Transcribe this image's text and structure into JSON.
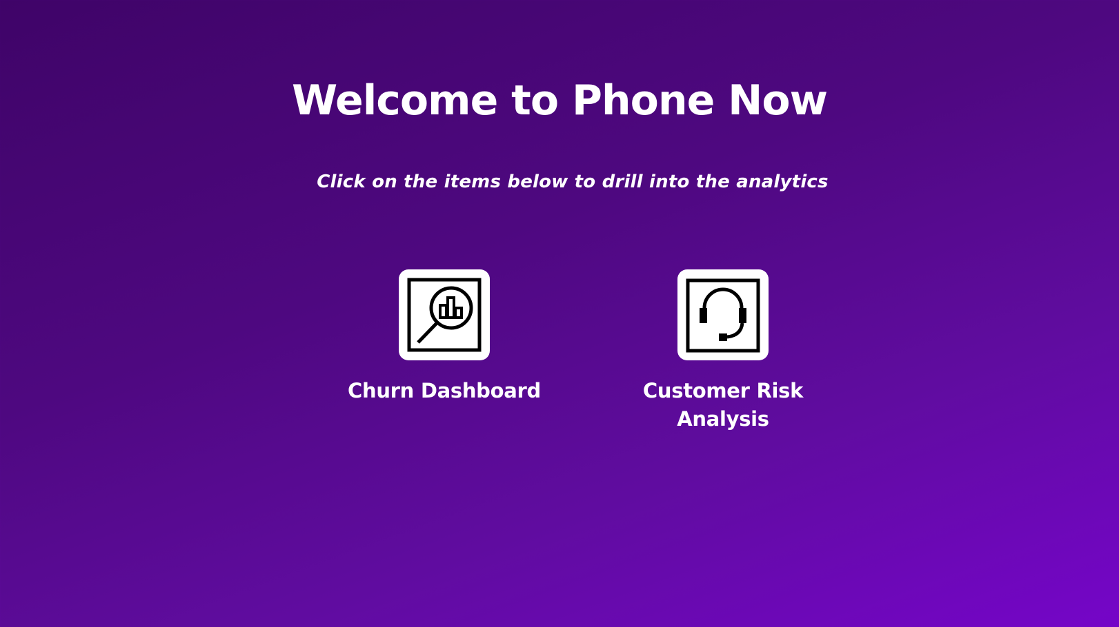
{
  "header": {
    "title": "Welcome to Phone Now",
    "subtitle": "Click on the items below to drill into the analytics"
  },
  "tiles": [
    {
      "label": "Churn Dashboard",
      "icon": "magnifier-chart-icon"
    },
    {
      "label": "Customer Risk\nAnalysis",
      "icon": "headset-icon"
    }
  ],
  "colors": {
    "background_start": "#3f0468",
    "background_end": "#7505c8",
    "text": "#ffffff",
    "tile_background": "#ffffff",
    "icon_stroke": "#000000"
  }
}
